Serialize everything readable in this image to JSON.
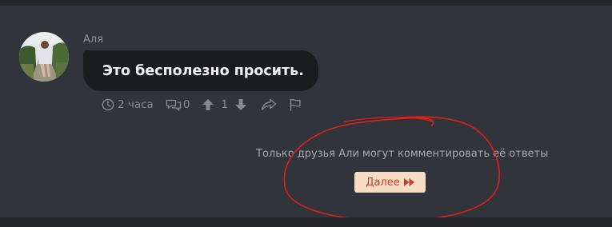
{
  "comment": {
    "author": "Аля",
    "text": "Это бесполезно просить.",
    "time": "2 часа",
    "replies_count": "0",
    "votes": "1",
    "icons": [
      "clock-icon",
      "comments-icon",
      "upvote-icon",
      "downvote-icon",
      "share-icon",
      "flag-icon"
    ]
  },
  "notice": {
    "text": "Только друзья Али могут комментировать её ответы",
    "button_label": "Далее",
    "button_icon": "fast-forward-icon"
  },
  "colors": {
    "background": "#32343b",
    "bubble": "#1b1c20",
    "button_bg": "#f6dcc3",
    "button_text": "#c2412a",
    "annotation": "#e0201c"
  }
}
